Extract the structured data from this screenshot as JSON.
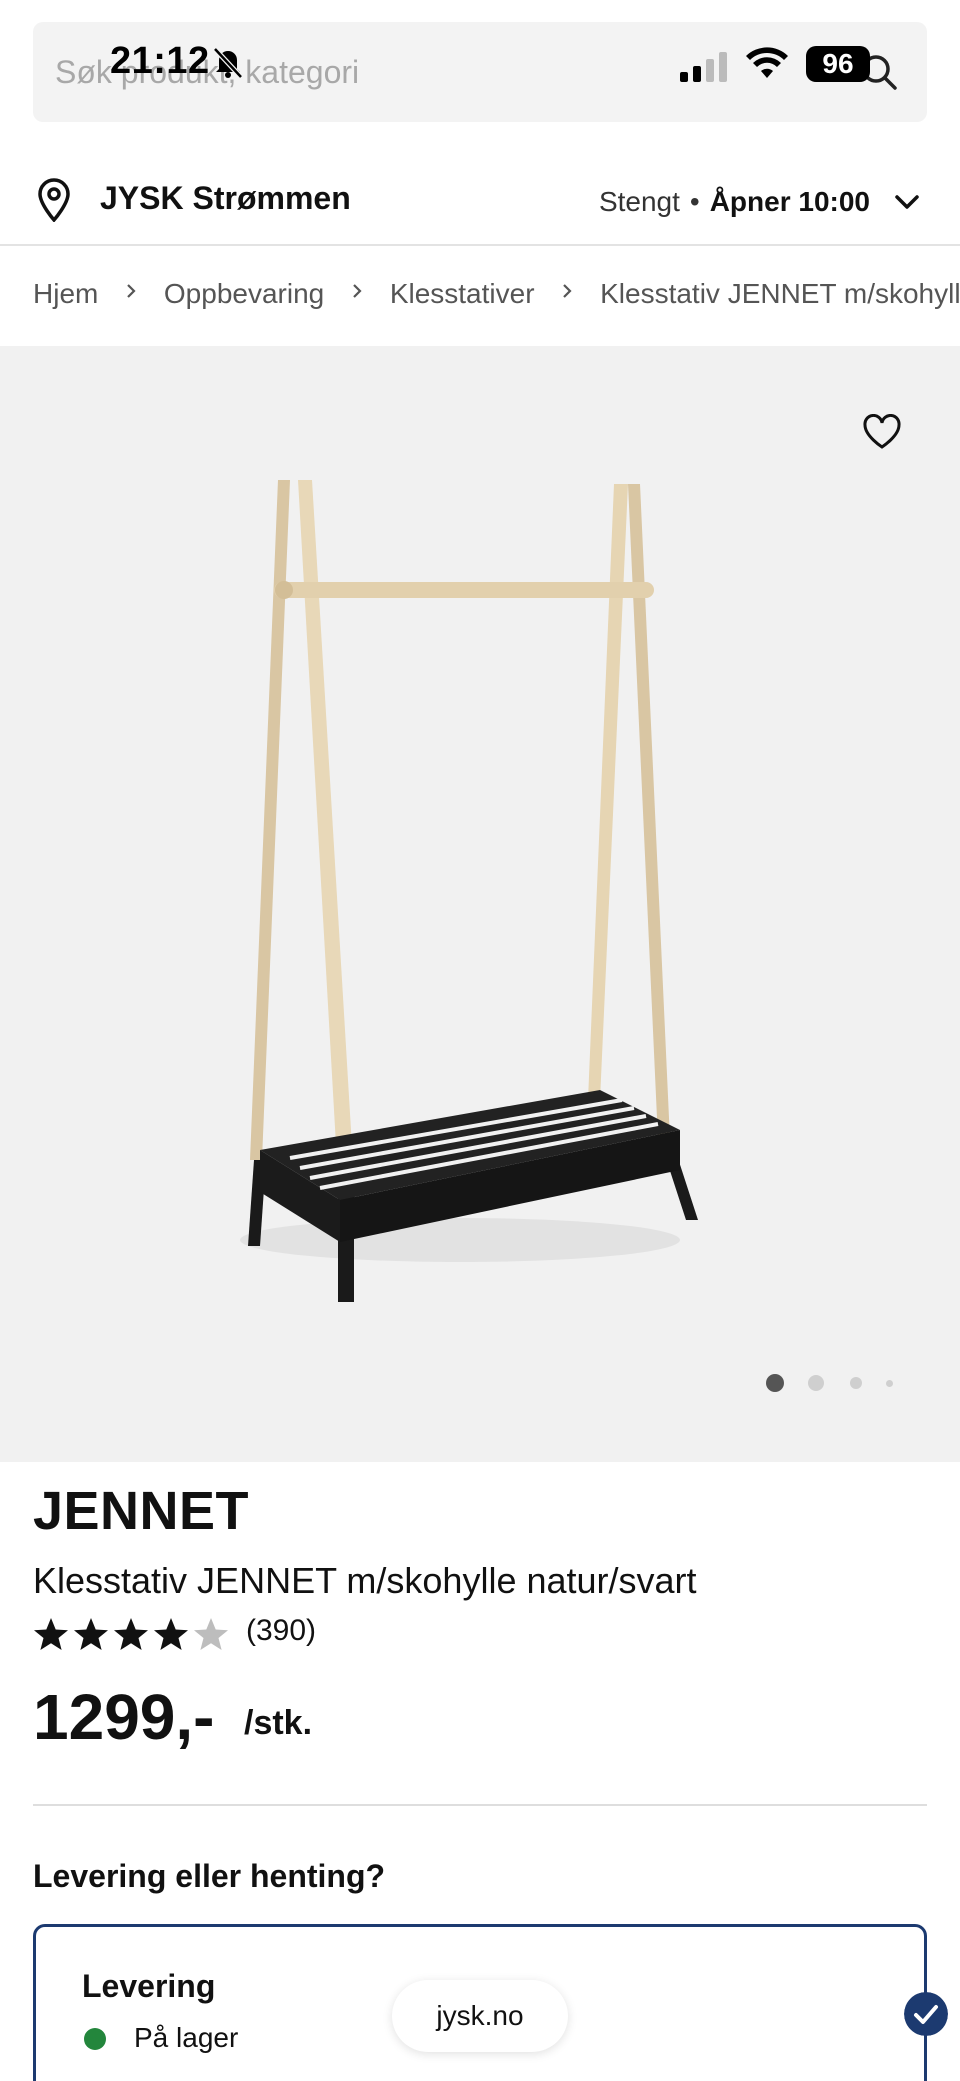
{
  "status_bar": {
    "time": "21:12",
    "battery": "96"
  },
  "search": {
    "placeholder": "Søk produkt, kategori"
  },
  "store": {
    "name": "JYSK Strømmen",
    "status": "Stengt",
    "opens": "Åpner 10:00"
  },
  "breadcrumb": [
    "Hjem",
    "Oppbevaring",
    "Klesstativer",
    "Klesstativ JENNET m/skohylle natur/svart"
  ],
  "product": {
    "brand": "JENNET",
    "name": "Klesstativ JENNET m/skohylle natur/svart",
    "rating": 4.5,
    "review_count": "(390)",
    "price": "1299,-",
    "unit": "/stk."
  },
  "gallery": {
    "image_count": 4,
    "active_index": 0
  },
  "delivery": {
    "question": "Levering eller henting?",
    "option_title": "Levering",
    "stock_status": "På lager"
  },
  "browser": {
    "url": "jysk.no"
  },
  "colors": {
    "brand_navy": "#1c3a70",
    "in_stock_green": "#23863c"
  }
}
